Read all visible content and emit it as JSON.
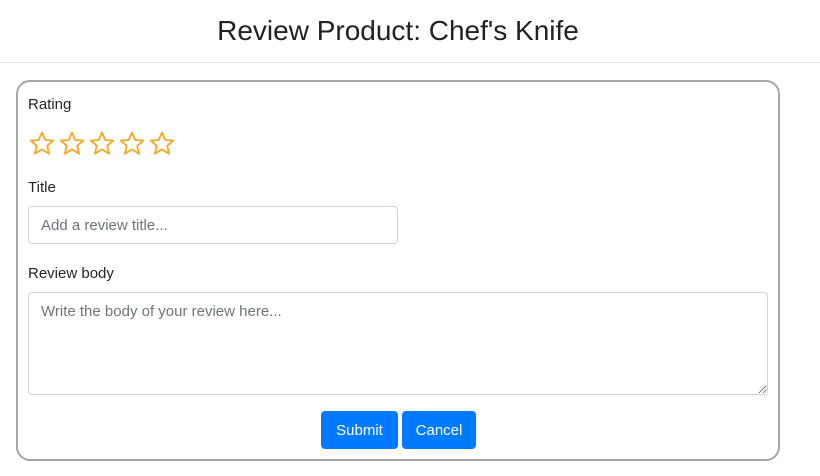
{
  "header": {
    "title": "Review Product: Chef's Knife"
  },
  "form": {
    "rating": {
      "label": "Rating",
      "max": 5,
      "value": 0,
      "star_color": "#f5a623",
      "icon": "star-outline-icon"
    },
    "title_field": {
      "label": "Title",
      "placeholder": "Add a review title...",
      "value": ""
    },
    "body_field": {
      "label": "Review body",
      "placeholder": "Write the body of your review here...",
      "value": ""
    },
    "buttons": {
      "submit_label": "Submit",
      "cancel_label": "Cancel",
      "color": "#007bff"
    }
  }
}
